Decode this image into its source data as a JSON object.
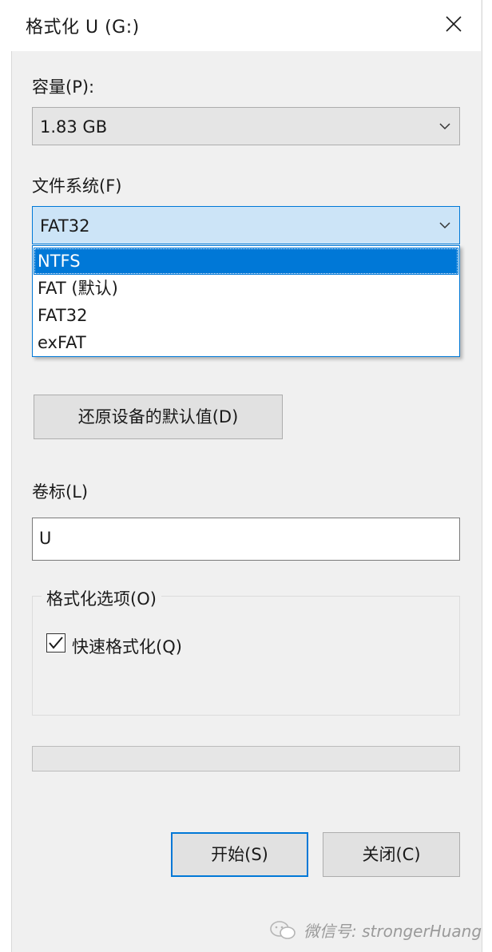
{
  "window": {
    "title": "格式化 U (G:)"
  },
  "capacity": {
    "label": "容量(P):",
    "value": "1.83 GB"
  },
  "filesystem": {
    "label": "文件系统(F)",
    "value": "FAT32",
    "options": [
      "NTFS",
      "FAT (默认)",
      "FAT32",
      "exFAT"
    ],
    "highlighted": "NTFS"
  },
  "restore_button": "还原设备的默认值(D)",
  "volume_label": {
    "label": "卷标(L)",
    "value": "U"
  },
  "format_options": {
    "group_title": "格式化选项(O)",
    "quick_format_label": "快速格式化(Q)",
    "quick_format_checked": true
  },
  "progress": {
    "value": 0
  },
  "buttons": {
    "start": "开始(S)",
    "close": "关闭(C)"
  },
  "watermark": "微信号: strongerHuang",
  "colors": {
    "accent": "#0078d7",
    "dialog_bg": "#f0f0f0"
  }
}
